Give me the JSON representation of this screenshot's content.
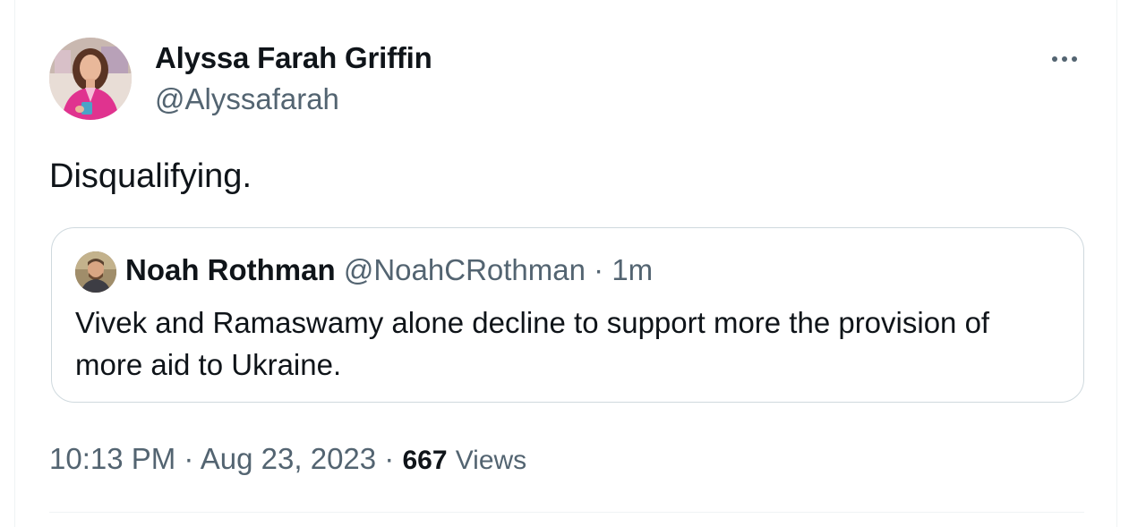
{
  "tweet": {
    "author": {
      "name": "Alyssa Farah Griffin",
      "handle": "@Alyssafarah"
    },
    "text": "Disqualifying.",
    "more_icon": "more-horizontal-icon",
    "quote": {
      "author": {
        "name": "Noah Rothman",
        "handle": "@NoahCRothman"
      },
      "separator": "·",
      "time": "1m",
      "text": "Vivek and Ramaswamy alone decline to support more the provision of more aid to Ukraine."
    },
    "meta": {
      "time": "10:13 PM",
      "separator1": "·",
      "date": "Aug 23, 2023",
      "separator2": "·",
      "views_count": "667",
      "views_label": "Views"
    }
  },
  "colors": {
    "text_primary": "#0f1419",
    "text_secondary": "#536471",
    "border": "#cfd9de",
    "accent_pink": "#e0338f"
  }
}
